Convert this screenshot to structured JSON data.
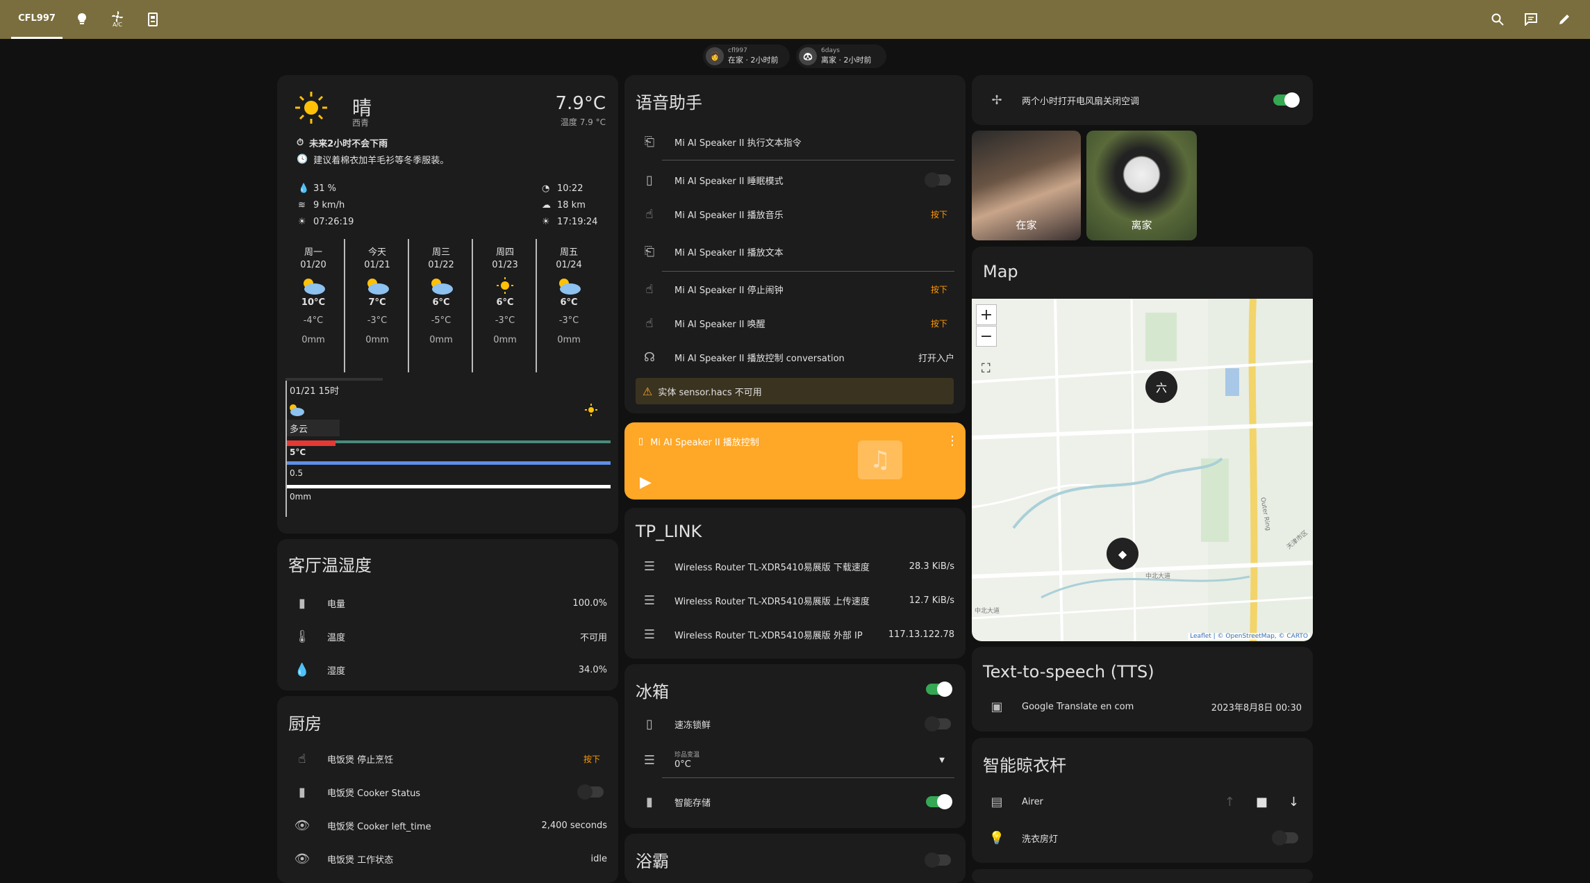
{
  "header": {
    "home_tab": "CFL997",
    "ac_tab_label": "A/C",
    "icons": [
      "lightbulb-icon",
      "fan-ac-icon",
      "remote-icon",
      "search-icon",
      "chat-icon",
      "pencil-icon"
    ]
  },
  "persons": [
    {
      "name": "cfl997",
      "status": "在家 · 2小时前"
    },
    {
      "name": "6days",
      "status": "离家 · 2小时前"
    }
  ],
  "weather": {
    "condition": "晴",
    "location": "西青",
    "temp": "7.9°C",
    "feels": "温度 7.9 °C",
    "rain_alert": "未来2小时不会下雨",
    "advice": "建议着棉衣加羊毛衫等冬季服装。",
    "humidity": "31 %",
    "wind": "9 km/h",
    "sunrise": "07:26:19",
    "uv_time": "10:22",
    "visibility": "18 km",
    "sunset": "17:19:24",
    "forecast": [
      {
        "day": "周一",
        "date": "01/20",
        "high": "10°C",
        "low": "-4°C",
        "rain": "0mm",
        "icon": "partly-cloudy"
      },
      {
        "day": "今天",
        "date": "01/21",
        "high": "7°C",
        "low": "-3°C",
        "rain": "0mm",
        "icon": "partly-cloudy"
      },
      {
        "day": "周三",
        "date": "01/22",
        "high": "6°C",
        "low": "-5°C",
        "rain": "0mm",
        "icon": "partly-cloudy"
      },
      {
        "day": "周四",
        "date": "01/23",
        "high": "6°C",
        "low": "-3°C",
        "rain": "0mm",
        "icon": "sunny"
      },
      {
        "day": "周五",
        "date": "01/24",
        "high": "6°C",
        "low": "-3°C",
        "rain": "0mm",
        "icon": "partly-cloudy"
      }
    ],
    "hourly_time": "01/21 15时",
    "hourly_cond": "多云",
    "hourly_temp": "5°C",
    "hourly_wind": "0.5",
    "hourly_rain": "0mm"
  },
  "voice": {
    "title": "语音助手",
    "rows": [
      {
        "label": "Mi AI Speaker II 执行文本指令",
        "icon": "text-command-icon"
      },
      {
        "label": "Mi AI Speaker II 睡眠模式",
        "icon": "phone-icon",
        "toggle": "off"
      },
      {
        "label": "Mi AI Speaker II 播放音乐",
        "icon": "touch-app-icon",
        "action": "按下"
      },
      {
        "label": "Mi AI Speaker II 播放文本",
        "icon": "text-command-icon"
      },
      {
        "label": "Mi AI Speaker II 停止闹钟",
        "icon": "touch-app-icon",
        "action": "按下"
      },
      {
        "label": "Mi AI Speaker II 唤醒",
        "icon": "touch-app-icon",
        "action": "按下"
      },
      {
        "label": "Mi AI Speaker II 播放控制 conversation",
        "icon": "voice-icon",
        "value": "打开入户"
      }
    ],
    "warning": "实体 sensor.hacs 不可用"
  },
  "media": {
    "title": "Mi AI Speaker II 播放控制",
    "accent": "#ffa726"
  },
  "tplink": {
    "title": "TP_LINK",
    "rows": [
      {
        "label": "Wireless Router TL-XDR5410易展版 下载速度",
        "value": "28.3 KiB/s"
      },
      {
        "label": "Wireless Router TL-XDR5410易展版 上传速度",
        "value": "12.7 KiB/s"
      },
      {
        "label": "Wireless Router TL-XDR5410易展版 外部 IP",
        "value": "117.13.122.78"
      }
    ]
  },
  "fridge": {
    "title": "冰箱",
    "rows": [
      {
        "label": "速冻锁鲜",
        "toggle": "off"
      },
      {
        "label": "珍品变温",
        "value": "0°C"
      },
      {
        "label": "智能存储",
        "toggle": "on"
      }
    ]
  },
  "bath": {
    "title": "浴霸"
  },
  "automation": {
    "label": "两个小时打开电风扇关闭空调"
  },
  "photos": [
    {
      "label": "在家"
    },
    {
      "label": "离家"
    }
  ],
  "map": {
    "title": "Map",
    "marker_label": "六",
    "road1": "中北大道",
    "road2": "中北大道",
    "ring": "Outer Ring",
    "diag": "天津市区",
    "attribution": "Leaflet | © OpenStreetMap, © CARTO"
  },
  "tts": {
    "title": "Text-to-speech (TTS)",
    "label": "Google Translate en com",
    "value": "2023年8月8日 00:30"
  },
  "airer": {
    "title": "智能晾衣杆",
    "rows": [
      {
        "label": "Airer"
      },
      {
        "label": "洗衣房灯",
        "toggle": "off"
      }
    ]
  },
  "living": {
    "title": "客厅温湿度",
    "rows": [
      {
        "label": "电量",
        "value": "100.0%",
        "icon": "battery-icon"
      },
      {
        "label": "温度",
        "value": "不可用",
        "icon": "thermometer-icon"
      },
      {
        "label": "湿度",
        "value": "34.0%",
        "icon": "water-percent-icon"
      }
    ]
  },
  "kitchen": {
    "title": "厨房",
    "rows": [
      {
        "label": "电饭煲 停止烹饪",
        "action": "按下",
        "icon": "touch-app-icon"
      },
      {
        "label": "电饭煲 Cooker Status",
        "toggle": "off",
        "icon": "cooker-icon"
      },
      {
        "label": "电饭煲 Cooker left_time",
        "value": "2,400 seconds",
        "icon": "eye-icon"
      },
      {
        "label": "电饭煲 工作状态",
        "value": "idle",
        "icon": "eye-icon"
      }
    ]
  }
}
